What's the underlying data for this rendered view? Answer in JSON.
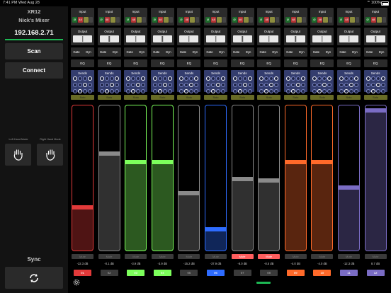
{
  "status_bar": {
    "time": "7:41 PM",
    "date": "Wed Aug 28",
    "battery": "100%"
  },
  "left_panel": {
    "model": "XR12",
    "mixer_name": "Nick's Mixer",
    "ip": "192.168.2.71",
    "scan_label": "Scan",
    "connect_label": "Connect",
    "left_hand_label": "Left Hand Mode",
    "right_hand_label": "Right Hand Mode",
    "sync_label": "Sync"
  },
  "labels": {
    "input": "Input",
    "output": "Output",
    "gate": "Gate",
    "dyn": "Dyn",
    "eq": "EQ",
    "sends": "Sends",
    "solo": "Solo",
    "mute": "Mute",
    "phantom": "Ø",
    "hpf": "48"
  },
  "colors": {
    "accent": "#1db954",
    "mute_on": "#ff5e5e",
    "solo": "#686b26",
    "sends_bg": "#343d6e"
  },
  "channels": [
    {
      "number": "01",
      "db": "-22.3 dB",
      "level": 0.3,
      "color": "#e23a3a",
      "mute": false
    },
    {
      "number": "02",
      "db": "-0.1 dB",
      "level": 0.68,
      "color": "#8a8a8a",
      "mute": false
    },
    {
      "number": "03",
      "db": "-3.9 dB",
      "level": 0.62,
      "color": "#7dff5c",
      "mute": false
    },
    {
      "number": "04",
      "db": "-3.9 dB",
      "level": 0.62,
      "color": "#7dff5c",
      "mute": false
    },
    {
      "number": "05",
      "db": "-15.2 dB",
      "level": 0.4,
      "color": "#8a8a8a",
      "mute": false
    },
    {
      "number": "06",
      "db": "-37.9 dB",
      "level": 0.15,
      "color": "#2e6cff",
      "mute": false
    },
    {
      "number": "07",
      "db": "-8.0 dB",
      "level": 0.5,
      "color": "#8a8a8a",
      "mute": true
    },
    {
      "number": "08",
      "db": "-8.5 dB",
      "level": 0.49,
      "color": "#8a8a8a",
      "mute": true
    },
    {
      "number": "09",
      "db": "-4.0 dB",
      "level": 0.62,
      "color": "#ff6a2a",
      "mute": false
    },
    {
      "number": "10",
      "db": "-4.0 dB",
      "level": 0.62,
      "color": "#ff6a2a",
      "mute": false
    },
    {
      "number": "11",
      "db": "-12.3 dB",
      "level": 0.44,
      "color": "#7a6cc4",
      "mute": false
    },
    {
      "number": "12",
      "db": "8.7 dB",
      "level": 0.98,
      "color": "#7a6cc4",
      "mute": false
    }
  ]
}
